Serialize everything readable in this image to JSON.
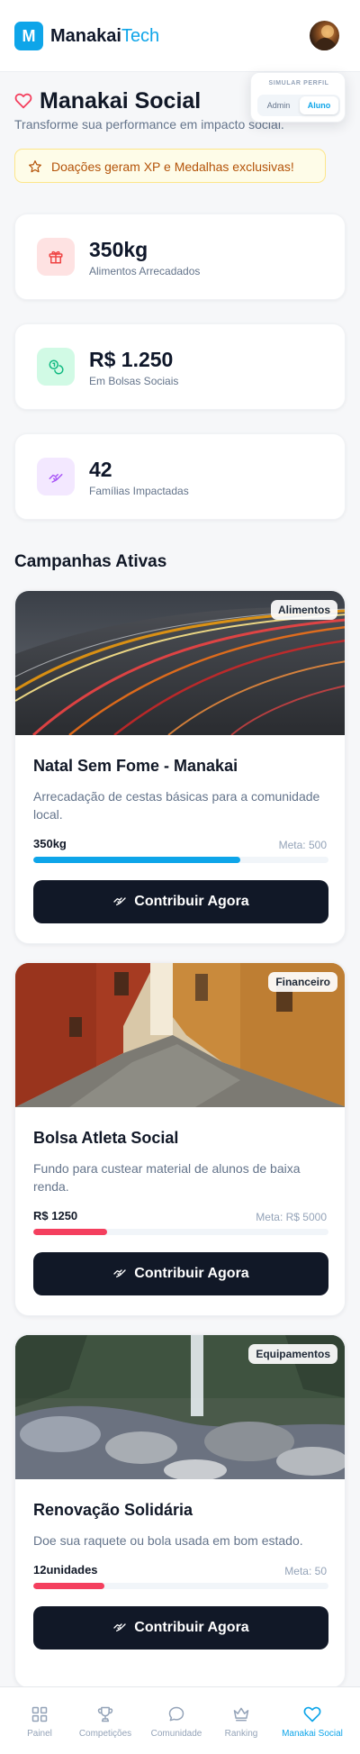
{
  "header": {
    "logo_letter": "M",
    "brand_main": "Manakai",
    "brand_accent": "Tech"
  },
  "profile_switch": {
    "title": "SIMULAR PERFIL",
    "options": [
      "Admin",
      "Aluno"
    ],
    "selected": "Aluno"
  },
  "page": {
    "title": "Manakai Social",
    "subtitle": "Transforme sua performance em impacto social.",
    "banner": "Doações geram XP e Medalhas exclusivas!"
  },
  "stats": [
    {
      "value": "350kg",
      "label": "Alimentos Arrecadados",
      "icon": "gift-icon",
      "bg": "#fee2e2",
      "color": "#ef4444"
    },
    {
      "value": "R$ 1.250",
      "label": "Em Bolsas Sociais",
      "icon": "coins-icon",
      "bg": "#d1fae5",
      "color": "#10b981"
    },
    {
      "value": "42",
      "label": "Famílias Impactadas",
      "icon": "handshake-icon",
      "bg": "#f3e8ff",
      "color": "#a855f7"
    }
  ],
  "section_title": "Campanhas Ativas",
  "campaigns": [
    {
      "badge": "Alimentos",
      "title": "Natal Sem Fome - Manakai",
      "description": "Arrecadação de cestas básicas para a comunidade local.",
      "current": "350kg",
      "goal": "Meta: 500",
      "progress": 0.7,
      "bar_color": "#0ea5e9",
      "cta": "Contribuir Agora"
    },
    {
      "badge": "Financeiro",
      "title": "Bolsa Atleta Social",
      "description": "Fundo para custear material de alunos de baixa renda.",
      "current": "R$ 1250",
      "goal": "Meta: R$ 5000",
      "progress": 0.25,
      "bar_color": "#f43f5e",
      "cta": "Contribuir Agora"
    },
    {
      "badge": "Equipamentos",
      "title": "Renovação Solidária",
      "description": "Doe sua raquete ou bola usada em bom estado.",
      "current": "12unidades",
      "goal": "Meta: 50",
      "progress": 0.24,
      "bar_color": "#f43f5e",
      "cta": "Contribuir Agora"
    }
  ],
  "bottom_nav": [
    {
      "label": "Painel",
      "icon": "grid-icon",
      "active": false
    },
    {
      "label": "Competições",
      "icon": "trophy-icon",
      "active": false
    },
    {
      "label": "Comunidade",
      "icon": "chat-bubble-icon",
      "active": false
    },
    {
      "label": "Ranking",
      "icon": "crown-icon",
      "active": false
    },
    {
      "label": "Manakai Social",
      "icon": "heart-icon",
      "active": true
    }
  ],
  "colors": {
    "accent": "#0ea5e9",
    "heart": "#f43f5e",
    "dark_button": "#111827"
  }
}
